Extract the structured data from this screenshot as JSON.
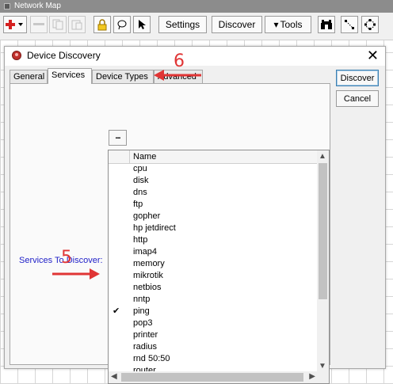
{
  "window": {
    "title": "Network Map"
  },
  "toolbar": {
    "settings_label": "Settings",
    "discover_label": "Discover",
    "tools_label": "Tools",
    "tools_arrow": "▾"
  },
  "dialog": {
    "title": "Device Discovery",
    "close_glyph": "✕",
    "tabs": [
      {
        "label": "General"
      },
      {
        "label": "Services"
      },
      {
        "label": "Device Types"
      },
      {
        "label": "Advanced"
      }
    ],
    "discover_button": "Discover",
    "cancel_button": "Cancel",
    "services_label": "Services To Discover:",
    "dots_button": "...",
    "list_header": "Name",
    "services": [
      {
        "name": "cpu",
        "checked": false
      },
      {
        "name": "disk",
        "checked": false
      },
      {
        "name": "dns",
        "checked": false
      },
      {
        "name": "ftp",
        "checked": false
      },
      {
        "name": "gopher",
        "checked": false
      },
      {
        "name": "hp jetdirect",
        "checked": false
      },
      {
        "name": "http",
        "checked": false
      },
      {
        "name": "imap4",
        "checked": false
      },
      {
        "name": "memory",
        "checked": false
      },
      {
        "name": "mikrotik",
        "checked": false
      },
      {
        "name": "netbios",
        "checked": false
      },
      {
        "name": "nntp",
        "checked": false
      },
      {
        "name": "ping",
        "checked": true
      },
      {
        "name": "pop3",
        "checked": false
      },
      {
        "name": "printer",
        "checked": false
      },
      {
        "name": "radius",
        "checked": false
      },
      {
        "name": "rnd 50:50",
        "checked": false
      },
      {
        "name": "router",
        "checked": false
      }
    ],
    "check_glyph": "✔"
  },
  "annotations": [
    {
      "label": "5"
    },
    {
      "label": "6"
    }
  ],
  "colors": {
    "annotation": "#e03535",
    "label_blue": "#2222c8"
  }
}
